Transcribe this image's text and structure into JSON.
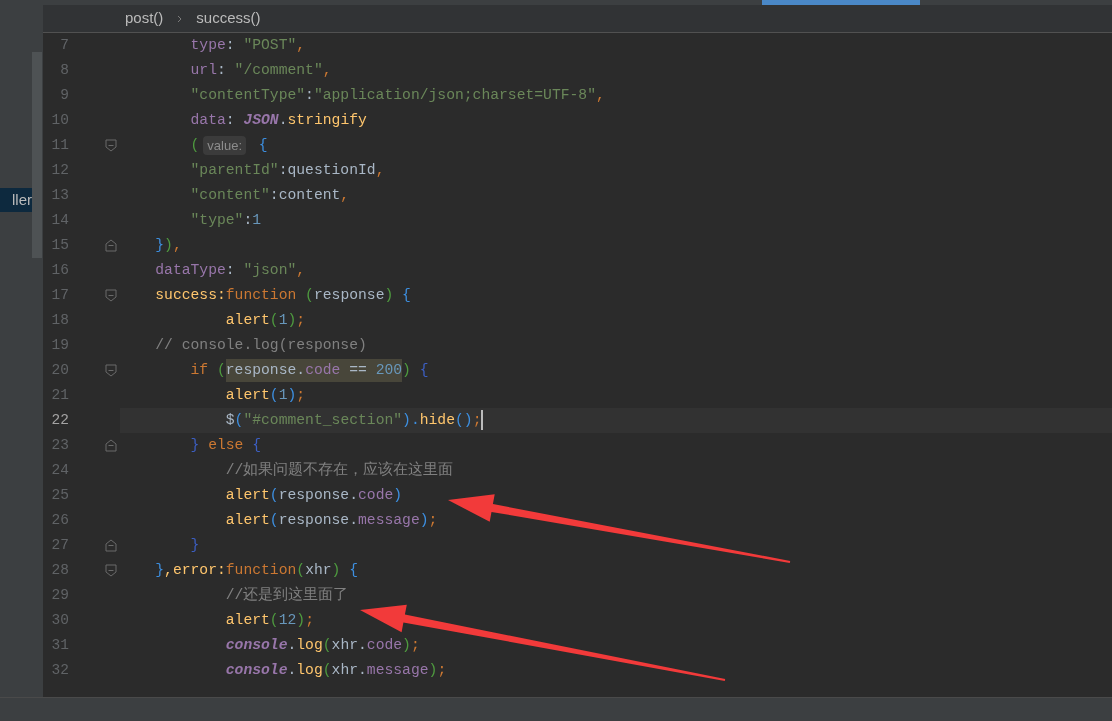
{
  "sidebar": {
    "items": [
      {
        "label": "ller",
        "selected": true
      }
    ]
  },
  "breadcrumb": [
    "post()",
    "success()"
  ],
  "editor": {
    "lines": [
      {
        "number": "7",
        "current": false,
        "tokens": [
          {
            "text": "        type",
            "kind": "key"
          },
          {
            "text": ": ",
            "kind": "plain"
          },
          {
            "text": "\"POST\"",
            "kind": "string"
          },
          {
            "text": ",",
            "kind": "punct"
          }
        ]
      },
      {
        "number": "8",
        "current": false,
        "tokens": [
          {
            "text": "        url",
            "kind": "key"
          },
          {
            "text": ": ",
            "kind": "plain"
          },
          {
            "text": "\"/comment\"",
            "kind": "string"
          },
          {
            "text": ",",
            "kind": "punct"
          }
        ]
      },
      {
        "number": "9",
        "current": false,
        "tokens": [
          {
            "text": "        \"contentType\"",
            "kind": "string"
          },
          {
            "text": ":",
            "kind": "plain"
          },
          {
            "text": "\"application/json;charset=UTF-8\"",
            "kind": "string"
          },
          {
            "text": ",",
            "kind": "punct"
          }
        ]
      },
      {
        "number": "10",
        "current": false,
        "tokens": [
          {
            "text": "        data",
            "kind": "key"
          },
          {
            "text": ": ",
            "kind": "plain"
          },
          {
            "text": "JSON",
            "kind": "global"
          },
          {
            "text": ".",
            "kind": "plain"
          },
          {
            "text": "stringify",
            "kind": "func"
          }
        ]
      },
      {
        "number": "11",
        "current": false,
        "fold": {
          "kind": "open"
        },
        "tokens": [
          {
            "text": "        (",
            "kind": "paren"
          },
          {
            "text": "value:",
            "kind": "hint"
          },
          {
            "text": " {",
            "kind": "brace"
          }
        ]
      },
      {
        "number": "12",
        "current": false,
        "tokens": [
          {
            "text": "        \"parentId\"",
            "kind": "string"
          },
          {
            "text": ":questionId",
            "kind": "plain"
          },
          {
            "text": ",",
            "kind": "punct"
          }
        ]
      },
      {
        "number": "13",
        "current": false,
        "tokens": [
          {
            "text": "        \"content\"",
            "kind": "string"
          },
          {
            "text": ":content",
            "kind": "plain"
          },
          {
            "text": ",",
            "kind": "punct"
          }
        ]
      },
      {
        "number": "14",
        "current": false,
        "tokens": [
          {
            "text": "        \"type\"",
            "kind": "string"
          },
          {
            "text": ":",
            "kind": "plain"
          },
          {
            "text": "1",
            "kind": "number"
          }
        ]
      },
      {
        "number": "15",
        "current": false,
        "fold": {
          "kind": "close"
        },
        "tokens": [
          {
            "text": "    }",
            "kind": "brace"
          },
          {
            "text": ")",
            "kind": "paren"
          },
          {
            "text": ",",
            "kind": "punct"
          }
        ]
      },
      {
        "number": "16",
        "current": false,
        "tokens": [
          {
            "text": "    dataType",
            "kind": "key"
          },
          {
            "text": ": ",
            "kind": "plain"
          },
          {
            "text": "\"json\"",
            "kind": "string"
          },
          {
            "text": ",",
            "kind": "punct"
          }
        ]
      },
      {
        "number": "17",
        "current": false,
        "fold": {
          "kind": "open"
        },
        "tokens": [
          {
            "text": "    success:",
            "kind": "func"
          },
          {
            "text": "function ",
            "kind": "keyword"
          },
          {
            "text": "(",
            "kind": "paren"
          },
          {
            "text": "response",
            "kind": "plain"
          },
          {
            "text": ")",
            "kind": "paren"
          },
          {
            "text": " {",
            "kind": "brace"
          }
        ]
      },
      {
        "number": "18",
        "current": false,
        "tokens": [
          {
            "text": "            alert",
            "kind": "func"
          },
          {
            "text": "(",
            "kind": "paren"
          },
          {
            "text": "1",
            "kind": "number"
          },
          {
            "text": ")",
            "kind": "paren"
          },
          {
            "text": ";",
            "kind": "punct"
          }
        ]
      },
      {
        "number": "19",
        "current": false,
        "tokens": [
          {
            "text": "    // console.log(response)",
            "kind": "comment"
          }
        ]
      },
      {
        "number": "20",
        "current": false,
        "fold": {
          "kind": "open"
        },
        "tokens": [
          {
            "text": "        if ",
            "kind": "keyword"
          },
          {
            "text": "(",
            "kind": "paren"
          },
          {
            "text": "response.",
            "kind": "plain",
            "highlighted": true
          },
          {
            "text": "code",
            "kind": "prop",
            "highlighted": true
          },
          {
            "text": " == ",
            "kind": "plain",
            "highlighted": true
          },
          {
            "text": "200",
            "kind": "number",
            "highlighted": true
          },
          {
            "text": ")",
            "kind": "paren"
          },
          {
            "text": " {",
            "kind": "brace2"
          }
        ]
      },
      {
        "number": "21",
        "current": false,
        "tokens": [
          {
            "text": "            alert",
            "kind": "func"
          },
          {
            "text": "(",
            "kind": "brace"
          },
          {
            "text": "1",
            "kind": "number"
          },
          {
            "text": ")",
            "kind": "brace"
          },
          {
            "text": ";",
            "kind": "punct"
          }
        ]
      },
      {
        "number": "22",
        "current": true,
        "tokens": [
          {
            "text": "            $",
            "kind": "plain"
          },
          {
            "text": "(",
            "kind": "brace"
          },
          {
            "text": "\"#comment_section\"",
            "kind": "string"
          },
          {
            "text": ").",
            "kind": "brace"
          },
          {
            "text": "hide",
            "kind": "func"
          },
          {
            "text": "()",
            "kind": "brace"
          },
          {
            "text": ";",
            "kind": "punct"
          }
        ]
      },
      {
        "number": "23",
        "current": false,
        "fold": {
          "kind": "close"
        },
        "tokens": [
          {
            "text": "        }",
            "kind": "brace2"
          },
          {
            "text": " else ",
            "kind": "keyword"
          },
          {
            "text": "{",
            "kind": "brace2"
          }
        ]
      },
      {
        "number": "24",
        "current": false,
        "tokens": [
          {
            "text": "            //如果问题不存在，应该在这里面",
            "kind": "comment"
          }
        ]
      },
      {
        "number": "25",
        "current": false,
        "tokens": [
          {
            "text": "            alert",
            "kind": "func"
          },
          {
            "text": "(",
            "kind": "brace"
          },
          {
            "text": "response.",
            "kind": "plain"
          },
          {
            "text": "code",
            "kind": "prop"
          },
          {
            "text": ")",
            "kind": "brace"
          }
        ]
      },
      {
        "number": "26",
        "current": false,
        "tokens": [
          {
            "text": "            alert",
            "kind": "func"
          },
          {
            "text": "(",
            "kind": "brace"
          },
          {
            "text": "response.",
            "kind": "plain"
          },
          {
            "text": "message",
            "kind": "prop"
          },
          {
            "text": ")",
            "kind": "brace"
          },
          {
            "text": ";",
            "kind": "punct"
          }
        ]
      },
      {
        "number": "27",
        "current": false,
        "fold": {
          "kind": "close"
        },
        "tokens": [
          {
            "text": "        }",
            "kind": "brace2"
          }
        ]
      },
      {
        "number": "28",
        "current": false,
        "fold": {
          "kind": "open"
        },
        "tokens": [
          {
            "text": "    }",
            "kind": "brace"
          },
          {
            "text": ",error:",
            "kind": "func"
          },
          {
            "text": "function",
            "kind": "keyword"
          },
          {
            "text": "(",
            "kind": "paren"
          },
          {
            "text": "xhr",
            "kind": "plain"
          },
          {
            "text": ")",
            "kind": "paren"
          },
          {
            "text": " {",
            "kind": "brace"
          }
        ]
      },
      {
        "number": "29",
        "current": false,
        "tokens": [
          {
            "text": "            //还是到这里面了",
            "kind": "comment"
          }
        ]
      },
      {
        "number": "30",
        "current": false,
        "tokens": [
          {
            "text": "            alert",
            "kind": "func"
          },
          {
            "text": "(",
            "kind": "paren"
          },
          {
            "text": "12",
            "kind": "number"
          },
          {
            "text": ")",
            "kind": "paren"
          },
          {
            "text": ";",
            "kind": "punct"
          }
        ]
      },
      {
        "number": "31",
        "current": false,
        "tokens": [
          {
            "text": "            console",
            "kind": "global"
          },
          {
            "text": ".",
            "kind": "plain"
          },
          {
            "text": "log",
            "kind": "func"
          },
          {
            "text": "(",
            "kind": "paren"
          },
          {
            "text": "xhr.",
            "kind": "plain"
          },
          {
            "text": "code",
            "kind": "prop"
          },
          {
            "text": ")",
            "kind": "paren"
          },
          {
            "text": ";",
            "kind": "punct"
          }
        ]
      },
      {
        "number": "32",
        "current": false,
        "tokens": [
          {
            "text": "            console",
            "kind": "global"
          },
          {
            "text": ".",
            "kind": "plain"
          },
          {
            "text": "log",
            "kind": "func"
          },
          {
            "text": "(",
            "kind": "paren"
          },
          {
            "text": "xhr.",
            "kind": "plain"
          },
          {
            "text": "message",
            "kind": "prop"
          },
          {
            "text": ")",
            "kind": "paren"
          },
          {
            "text": ";",
            "kind": "punct"
          }
        ]
      }
    ]
  }
}
